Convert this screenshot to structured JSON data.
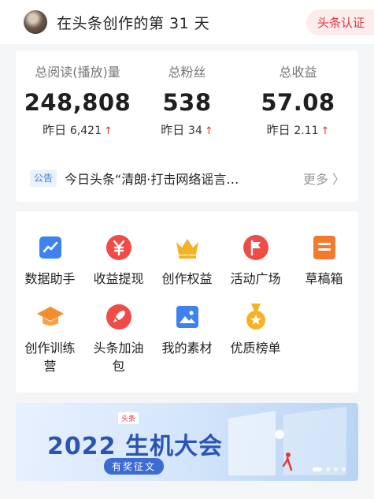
{
  "header": {
    "title": "在头条创作的第 31 天",
    "badge": "头条认证"
  },
  "stats": [
    {
      "label": "总阅读(播放)量",
      "value": "248,808",
      "delta_prefix": "昨日",
      "delta_value": "6,421",
      "trend": "up"
    },
    {
      "label": "总粉丝",
      "value": "538",
      "delta_prefix": "昨日",
      "delta_value": "34",
      "trend": "up"
    },
    {
      "label": "总收益",
      "value": "57.08",
      "delta_prefix": "昨日",
      "delta_value": "2.11",
      "trend": "up"
    }
  ],
  "notice": {
    "tag": "公告",
    "text": "今日头条“清朗·打击网络谣言…",
    "more": "更多 〉"
  },
  "tools": {
    "items": [
      {
        "label": "数据助手",
        "icon": "chart-icon",
        "color": "#3d82f0"
      },
      {
        "label": "收益提现",
        "icon": "yen-icon",
        "color": "#ef4b47"
      },
      {
        "label": "创作权益",
        "icon": "crown-icon",
        "color": "#f5b323"
      },
      {
        "label": "活动广场",
        "icon": "flag-icon",
        "color": "#ef4b47"
      },
      {
        "label": "草稿箱",
        "icon": "draft-icon",
        "color": "#f27a2d"
      },
      {
        "label": "创作训练营",
        "icon": "graduation-cap-icon",
        "color": "#f48d2b"
      },
      {
        "label": "头条加油包",
        "icon": "rocket-icon",
        "color": "#ef4b47"
      },
      {
        "label": "我的素材",
        "icon": "image-icon",
        "color": "#3d82f0"
      },
      {
        "label": "优质榜单",
        "icon": "medal-icon",
        "color": "#f5b323"
      }
    ],
    "labels_display": {
      "item5_line1": "创作训练",
      "item5_line2": "营",
      "item6_line1": "头条加油",
      "item6_line2": "包"
    }
  },
  "banner": {
    "logo": "头条",
    "title": "2022 生机大会",
    "subtitle": "有奖征文"
  },
  "colors": {
    "accent_red": "#e8333a",
    "accent_blue": "#3c7ce0",
    "background": "#f4f5f7"
  }
}
